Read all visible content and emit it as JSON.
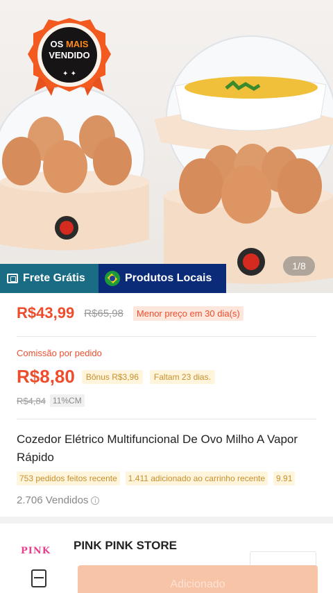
{
  "hero": {
    "badge": {
      "line1_a": "OS",
      "line1_b": "MAIS",
      "line2": "VENDIDO"
    },
    "image_counter": "1/8",
    "tags": {
      "frete": "Frete Grátis",
      "locais": "Produtos Locais"
    }
  },
  "price": {
    "current": "R$43,99",
    "original": "R$65,98",
    "lowest_note": "Menor preço em 30 dia(s)"
  },
  "commission": {
    "label": "Comissão por pedido",
    "value": "R$8,80",
    "bonus": "Bônus R$3,96",
    "remaining": "Faltam 23 dias.",
    "old_value": "R$4,84",
    "rate": "11%CM"
  },
  "product": {
    "title": "Cozedor Elétrico Multifuncional De Ovo Milho A Vapor Rápido",
    "stats": [
      "753 pedidos feitos recente",
      "1.411 adicionado ao carrinho recente",
      "9.91"
    ],
    "sold": "2.706 Vendidos"
  },
  "store": {
    "logo_text": "PINK",
    "name": "PINK PINK STORE"
  },
  "bottom": {
    "add_button": "Adicionado"
  },
  "colors": {
    "accent": "#ee4d2d",
    "tag_frete": "#1a6b84",
    "tag_locais": "#0b2a78",
    "store_logo": "#e83e8c"
  },
  "icons": [
    "medal-badge-icon",
    "truck-icon",
    "brazil-flag-icon",
    "info-icon",
    "store-menu-icon"
  ]
}
